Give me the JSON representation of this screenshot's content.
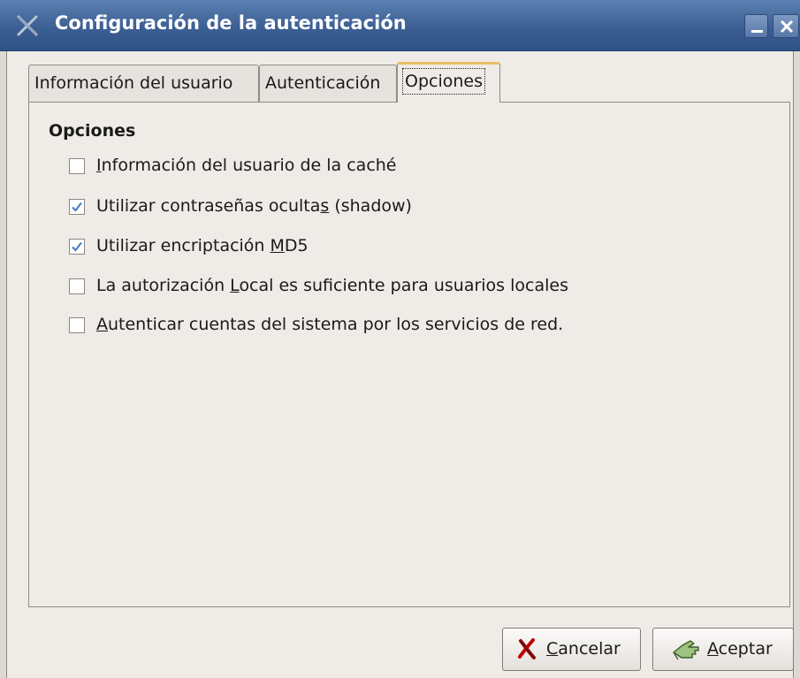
{
  "window": {
    "title": "Configuración de la autenticación",
    "controls": [
      "minimize-icon",
      "close-icon"
    ]
  },
  "tabs": [
    {
      "label": "Información del usuario",
      "selected": false
    },
    {
      "label": "Autenticación",
      "selected": false
    },
    {
      "label": "Opciones",
      "selected": true
    }
  ],
  "options": {
    "section_title": "Opciones",
    "items": [
      {
        "label_pre": "",
        "mnemonic": "I",
        "label_post": "nformación del usuario de la caché",
        "checked": false
      },
      {
        "label_pre": "Utilizar contraseñas oculta",
        "mnemonic": "s",
        "label_post": " (shadow)",
        "checked": true
      },
      {
        "label_pre": "Utilizar encriptación ",
        "mnemonic": "M",
        "label_post": "D5",
        "checked": true
      },
      {
        "label_pre": "La autorización ",
        "mnemonic": "L",
        "label_post": "ocal es suficiente para usuarios locales",
        "checked": false
      },
      {
        "label_pre": "",
        "mnemonic": "A",
        "label_post": "utenticar cuentas del sistema por los servicios de red.",
        "checked": false
      }
    ]
  },
  "buttons": {
    "cancel": {
      "mnemonic": "C",
      "rest": "ancelar",
      "icon": "cancel-x-icon"
    },
    "ok": {
      "mnemonic": "A",
      "rest": "ceptar",
      "icon": "ok-hand-icon"
    }
  },
  "colors": {
    "titlebar": "#3c5f94",
    "check": "#4a7fc1",
    "active_tab_accent": "#ebbf62",
    "cancel_icon": "#c00000"
  }
}
